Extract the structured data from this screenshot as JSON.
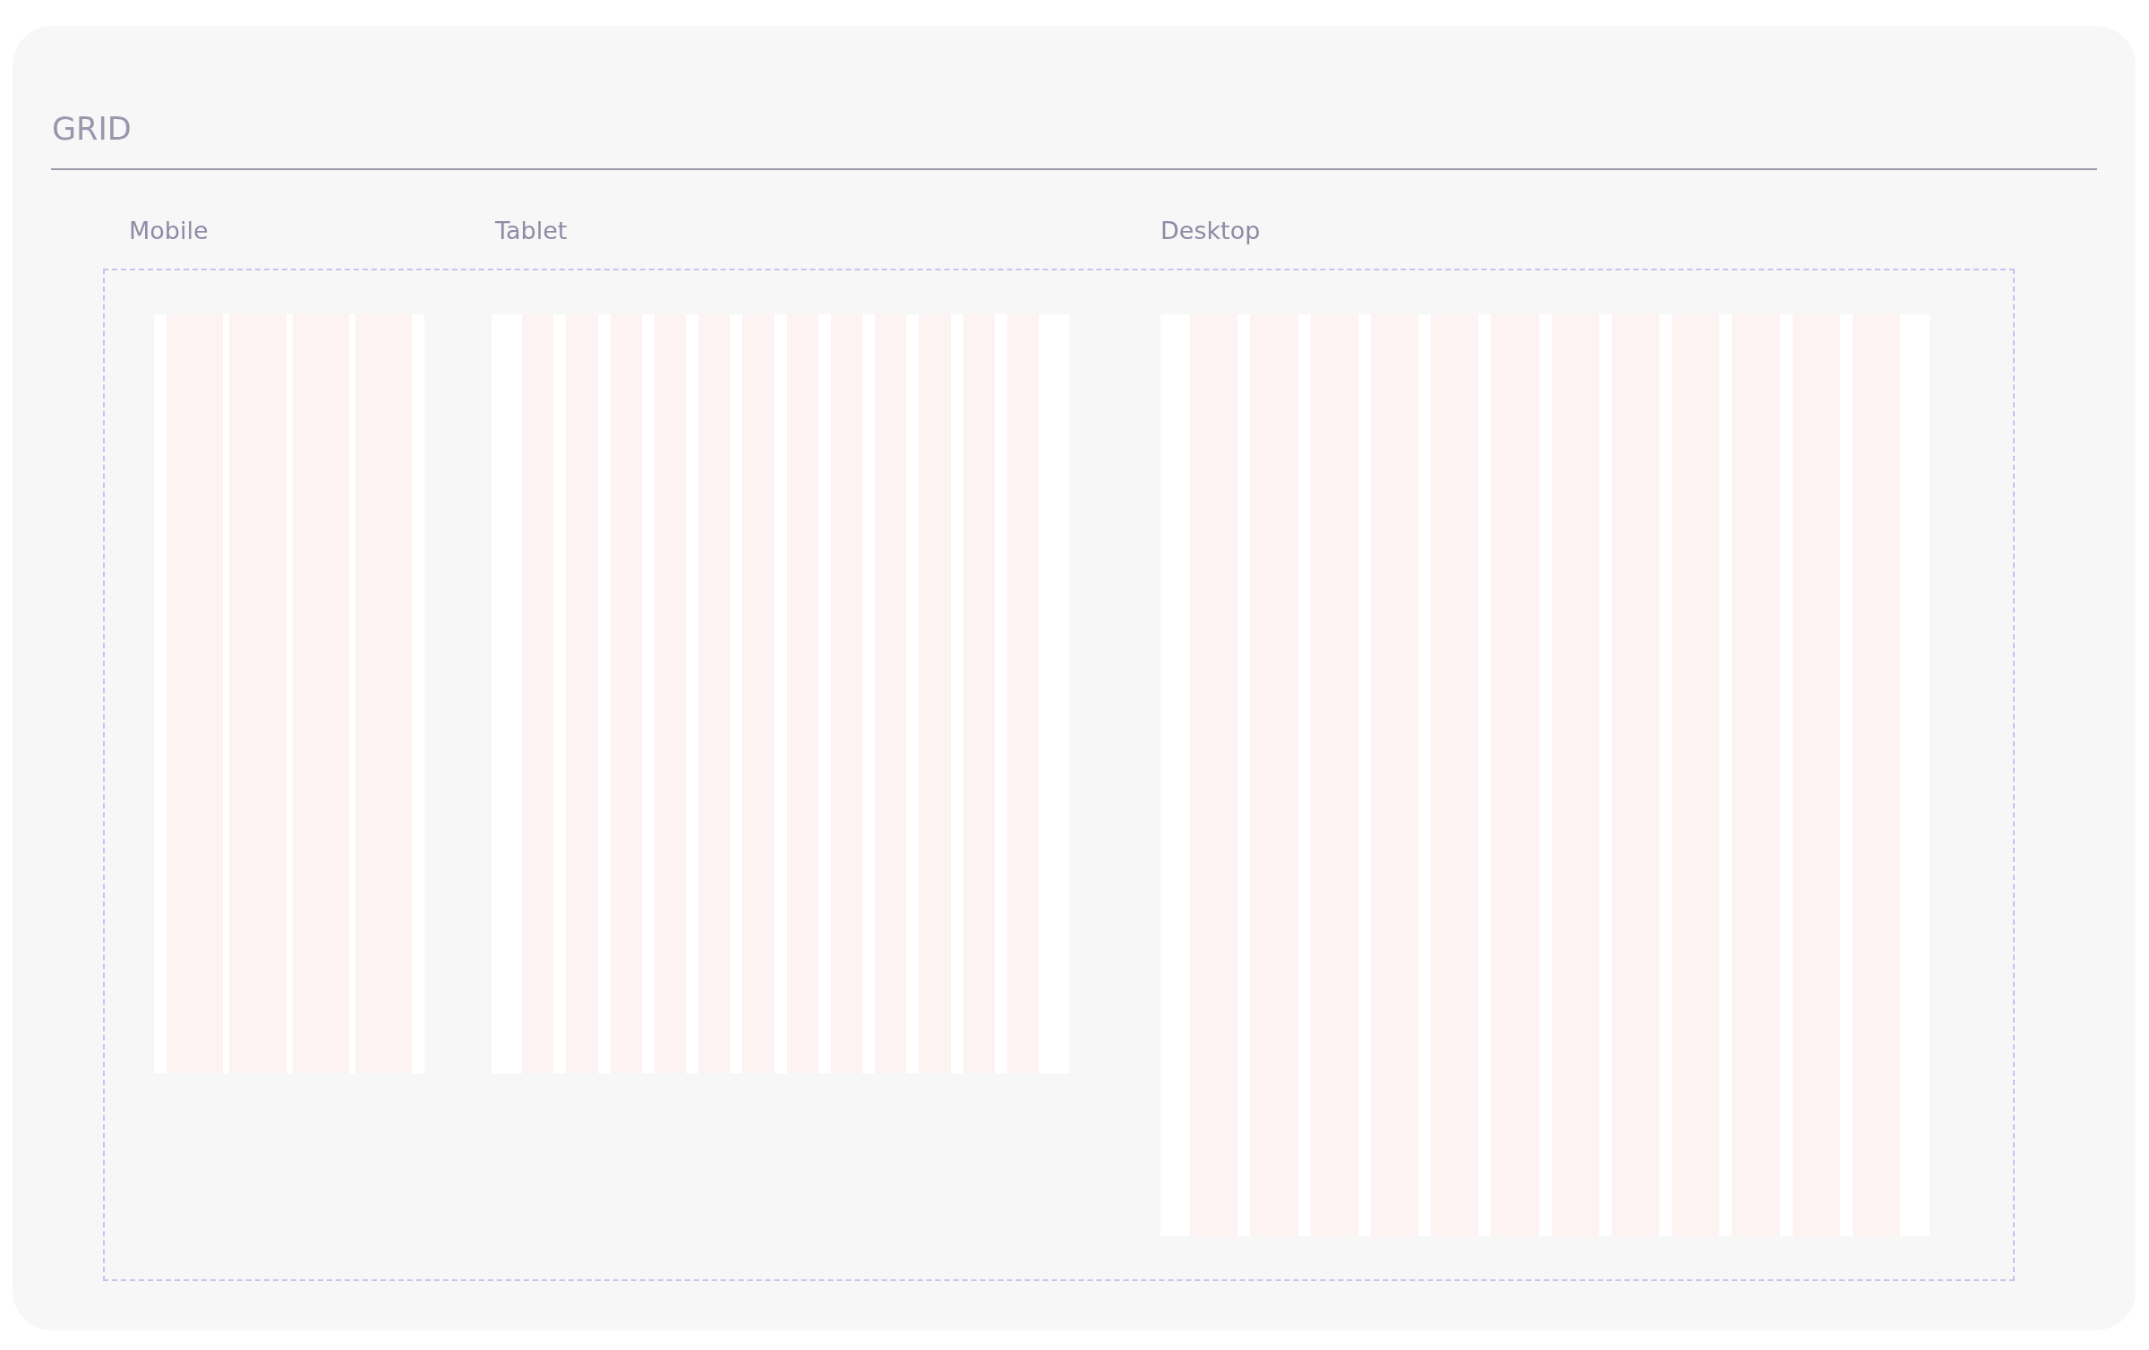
{
  "title": "GRID",
  "grids": [
    {
      "label": "Mobile",
      "kind": "mobile"
    },
    {
      "label": "Tablet",
      "kind": "tablet"
    },
    {
      "label": "Desktop",
      "kind": "desktop"
    }
  ]
}
